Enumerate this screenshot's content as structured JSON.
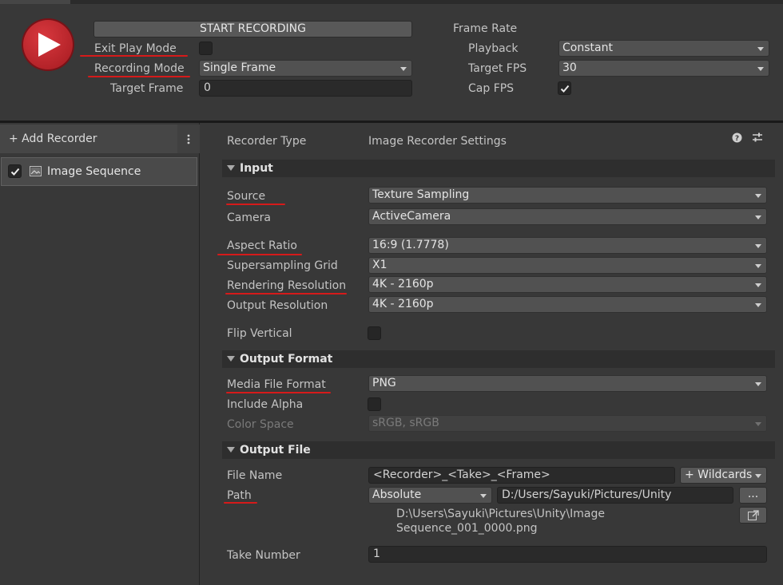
{
  "toolbar": {
    "start_recording_label": "START RECORDING",
    "exit_play_mode_label": "Exit Play Mode",
    "exit_play_mode_checked": false,
    "recording_mode_label": "Recording Mode",
    "recording_mode_value": "Single Frame",
    "target_frame_label": "Target Frame",
    "target_frame_value": "0"
  },
  "frame_rate": {
    "title": "Frame Rate",
    "playback_label": "Playback",
    "playback_value": "Constant",
    "target_fps_label": "Target FPS",
    "target_fps_value": "30",
    "cap_fps_label": "Cap FPS",
    "cap_fps_checked": true
  },
  "sidebar": {
    "add_recorder_label": "+ Add Recorder",
    "more_icon": "vertical-ellipsis-icon",
    "items": [
      {
        "label": "Image Sequence",
        "enabled": true,
        "icon": "image-icon"
      }
    ]
  },
  "recorder": {
    "type_label": "Recorder Type",
    "type_value": "Image Recorder Settings",
    "help_icon": "help-icon",
    "settings_icon": "sliders-icon"
  },
  "input": {
    "title": "Input",
    "source_label": "Source",
    "source_value": "Texture Sampling",
    "camera_label": "Camera",
    "camera_value": "ActiveCamera",
    "aspect_ratio_label": "Aspect Ratio",
    "aspect_ratio_value": "16:9 (1.7778)",
    "supersampling_label": "Supersampling Grid",
    "supersampling_value": "X1",
    "rendering_resolution_label": "Rendering Resolution",
    "rendering_resolution_value": "4K - 2160p",
    "output_resolution_label": "Output Resolution",
    "output_resolution_value": "4K - 2160p",
    "flip_vertical_label": "Flip Vertical",
    "flip_vertical_checked": false
  },
  "output_format": {
    "title": "Output Format",
    "media_file_format_label": "Media File Format",
    "media_file_format_value": "PNG",
    "include_alpha_label": "Include Alpha",
    "include_alpha_checked": false,
    "color_space_label": "Color Space",
    "color_space_value": "sRGB, sRGB"
  },
  "output_file": {
    "title": "Output File",
    "file_name_label": "File Name",
    "file_name_value": "<Recorder>_<Take>_<Frame>",
    "wildcards_label": "+ Wildcards",
    "path_label": "Path",
    "path_type_value": "Absolute",
    "path_value": "D:/Users/Sayuki/Pictures/Unity",
    "browse_label": "...",
    "resolved_path_line1": "D:\\Users\\Sayuki\\Pictures\\Unity\\Image",
    "resolved_path_line2": "Sequence_001_0000.png",
    "reveal_icon": "open-folder-icon",
    "take_number_label": "Take Number",
    "take_number_value": "1"
  },
  "colors": {
    "background": "#383838",
    "play_button": "#c1232a",
    "annotation_underline": "#d61a1a"
  }
}
